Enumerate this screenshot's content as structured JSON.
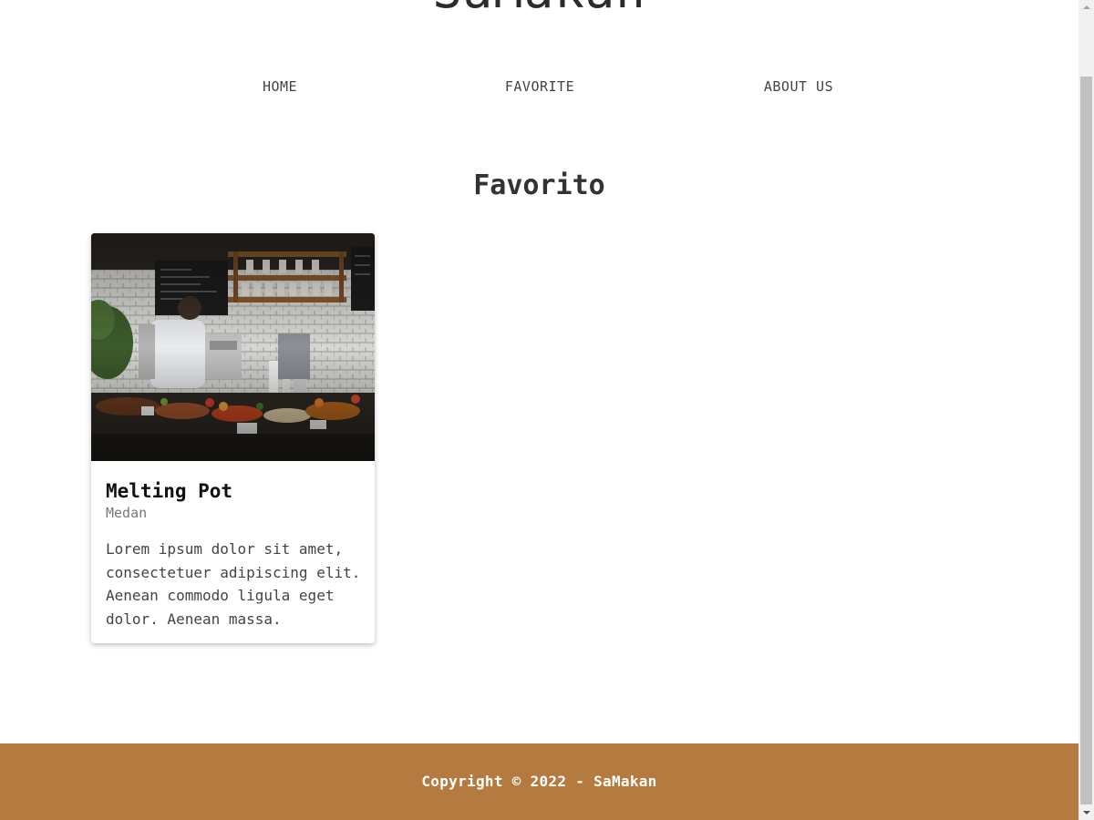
{
  "header": {
    "site_title": "SaMakan"
  },
  "nav": {
    "items": [
      {
        "label": "HOME"
      },
      {
        "label": "FAVORITE"
      },
      {
        "label": "ABOUT US"
      }
    ]
  },
  "main": {
    "section_title": "Favorito",
    "cards": [
      {
        "name": "Melting Pot",
        "city": "Medan",
        "description": "Lorem ipsum dolor sit amet, consectetuer adipiscing elit. Aenean commodo ligula eget dolor. Aenean massa."
      }
    ]
  },
  "footer": {
    "copyright": "Copyright © 2022 - SaMakan"
  },
  "colors": {
    "footer_background": "#b47a3f",
    "text_primary": "#333333"
  }
}
